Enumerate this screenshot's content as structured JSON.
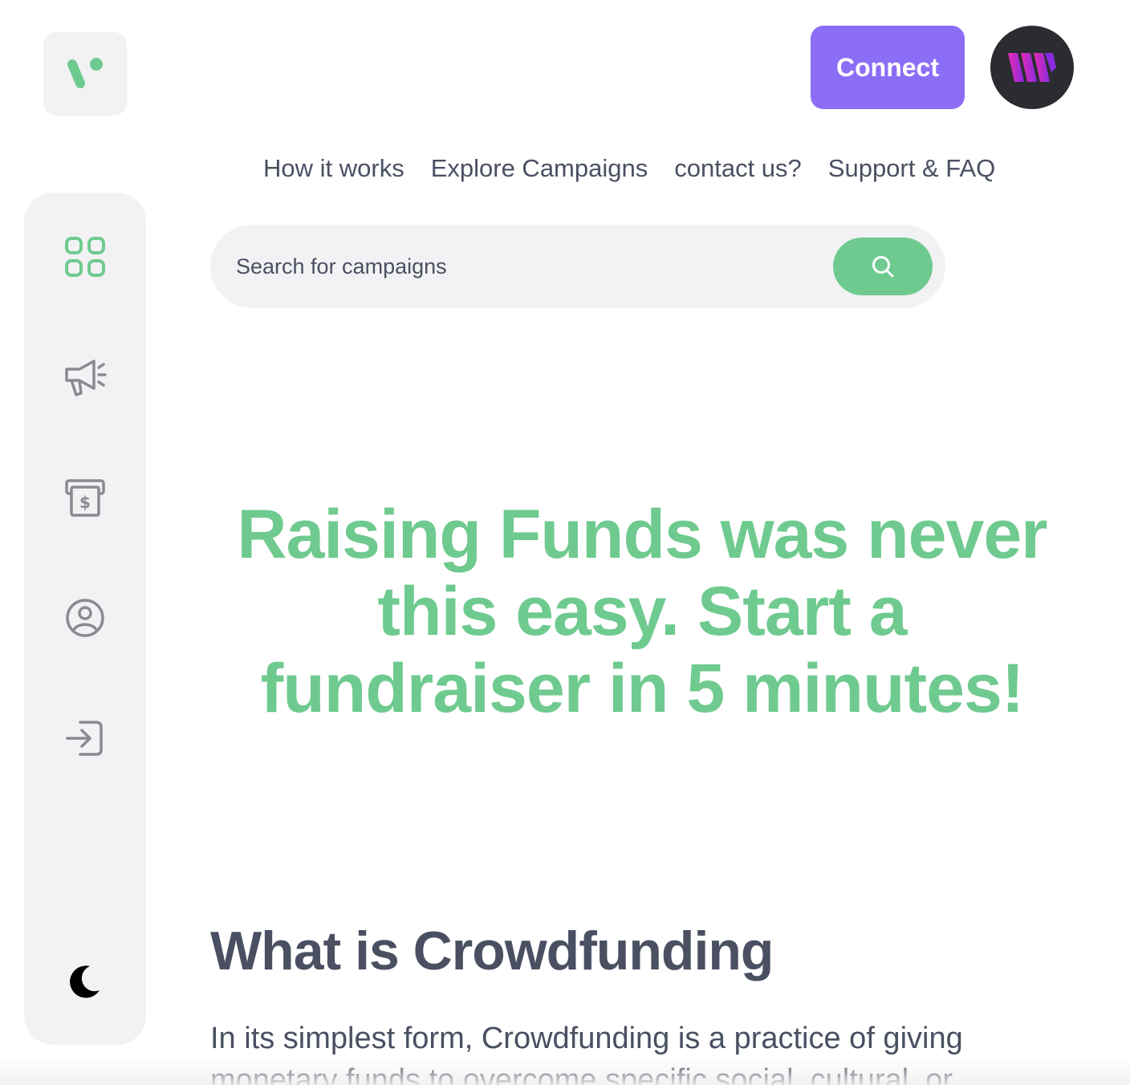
{
  "header": {
    "connect_label": "Connect"
  },
  "nav": {
    "items": [
      "How it works",
      "Explore Campaigns",
      "contact us?",
      "Support & FAQ"
    ]
  },
  "sidebar": {
    "icons": [
      "dashboard-grid-icon",
      "megaphone-icon",
      "money-withdraw-icon",
      "profile-icon",
      "logout-icon",
      "moon-icon"
    ]
  },
  "search": {
    "placeholder": "Search for campaigns"
  },
  "hero": {
    "headline": "Raising Funds was never this easy. Start a fundraiser in 5 minutes!"
  },
  "section": {
    "title": "What is Crowdfunding",
    "body": "In its simplest form, Crowdfunding is a practice of giving monetary funds to overcome specific social, cultural, or"
  },
  "colors": {
    "accent_green": "#6fca8f",
    "accent_purple": "#8c6df5",
    "text_gray": "#4a5062",
    "panel_gray": "#f2f2f4"
  }
}
